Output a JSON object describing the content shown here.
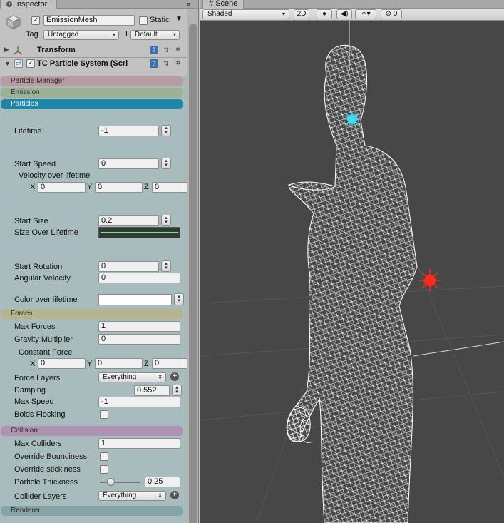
{
  "inspector": {
    "tab_label": "Inspector",
    "object_name": "EmissionMesh",
    "active_check": "✓",
    "static_label": "Static",
    "tag_label": "Tag",
    "tag_value": "Untagged",
    "layer_label": "Layer",
    "layer_value": "Default",
    "components": [
      {
        "name": "Transform"
      },
      {
        "name": "TC Particle System (Scri",
        "enabled_check": "✓"
      }
    ],
    "sections": {
      "particle_manager": "Particle Manager",
      "emission": "Emission",
      "particles": "Particles",
      "forces": "Forces",
      "collision": "Collision",
      "renderer": "Renderer"
    },
    "section_colors": {
      "particle_manager": "#b89ca0",
      "emission": "#9cb294",
      "particles": "#1f86a8",
      "forces": "#b5b48f",
      "collision": "#ad92b1",
      "renderer": "#86a3a5"
    },
    "particles": {
      "lifetime_label": "Lifetime",
      "lifetime_value": "-1",
      "start_speed_label": "Start Speed",
      "start_speed_value": "0",
      "velocity_label": "Velocity over lifetime",
      "x_label": "X",
      "x_value": "0",
      "y_label": "Y",
      "y_value": "0",
      "z_label": "Z",
      "z_value": "0",
      "start_size_label": "Start Size",
      "start_size_value": "0.2",
      "size_over_lifetime_label": "Size Over Lifetime",
      "start_rotation_label": "Start Rotation",
      "start_rotation_value": "0",
      "angular_velocity_label": "Angular Velocity",
      "angular_velocity_value": "0",
      "color_over_lifetime_label": "Color over lifetime"
    },
    "forces": {
      "max_forces_label": "Max Forces",
      "max_forces_value": "1",
      "gravity_label": "Gravity Multiplier",
      "gravity_value": "0",
      "constant_force_label": "Constant Force",
      "x_label": "X",
      "x_value": "0",
      "y_label": "Y",
      "y_value": "0",
      "z_label": "Z",
      "z_value": "0",
      "force_layers_label": "Force Layers",
      "force_layers_value": "Everything",
      "damping_label": "Damping",
      "damping_value": "0.552",
      "max_speed_label": "Max Speed",
      "max_speed_value": "-1",
      "boids_label": "Boids Flocking"
    },
    "collision": {
      "max_colliders_label": "Max Colliders",
      "max_colliders_value": "1",
      "override_bounciness_label": "Override Bounciness",
      "override_stickiness_label": "Override stickiness",
      "particle_thickness_label": "Particle Thickness",
      "particle_thickness_value": "0.25",
      "collider_layers_label": "Collider Layers",
      "collider_layers_value": "Everything"
    }
  },
  "scene": {
    "tab_label": "Scene",
    "shading_mode": "Shaded",
    "mode_2d": "2D",
    "effects_count": "0"
  },
  "icons": [
    "info-icon",
    "panel-menu-icon",
    "cube-icon",
    "transform-icon",
    "script-icon",
    "help-icon",
    "preset-icon",
    "gear-icon",
    "scene-grid-icon",
    "light-icon",
    "audio-icon",
    "effects-icon",
    "visibility-icon",
    "plus-icon",
    "light-gizmo-icon"
  ]
}
